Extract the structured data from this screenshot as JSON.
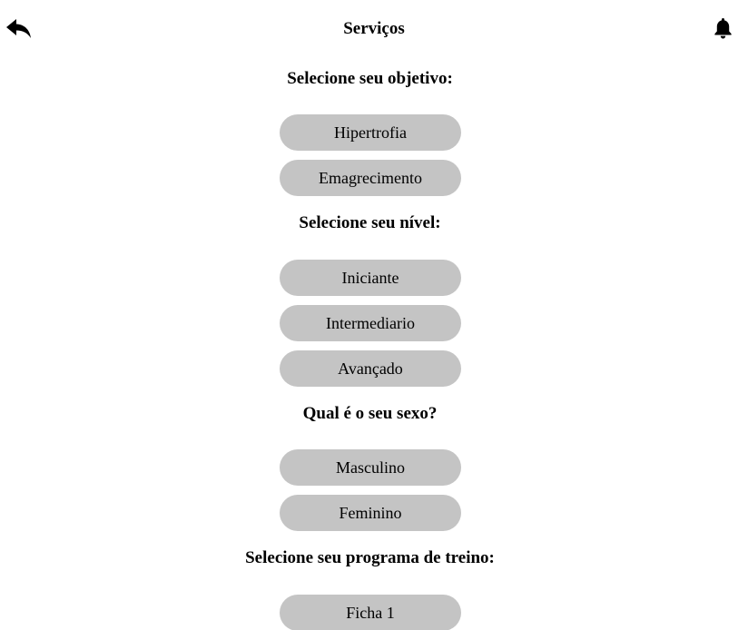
{
  "header": {
    "title": "Serviços",
    "back_icon": "reply-arrow-icon",
    "notification_icon": "bell-icon"
  },
  "colors": {
    "pill_background": "#c4c4c4",
    "text": "#000000",
    "background": "#ffffff"
  },
  "sections": {
    "objective": {
      "title": "Selecione seu objetivo:",
      "options": [
        "Hipertrofia",
        "Emagrecimento"
      ]
    },
    "level": {
      "title": "Selecione seu nível:",
      "options": [
        "Iniciante",
        "Intermediario",
        "Avançado"
      ]
    },
    "sex": {
      "title": "Qual é o seu sexo?",
      "options": [
        "Masculino",
        "Feminino"
      ]
    },
    "program": {
      "title": "Selecione seu programa de treino:",
      "options": [
        "Ficha 1"
      ]
    }
  }
}
